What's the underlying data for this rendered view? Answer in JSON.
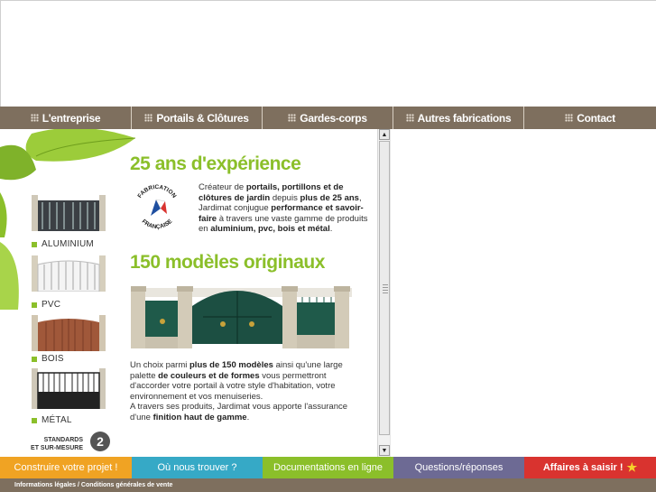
{
  "nav": {
    "items": [
      {
        "label": "L'entreprise"
      },
      {
        "label": "Portails & Clôtures"
      },
      {
        "label": "Gardes-corps"
      },
      {
        "label": "Autres fabrications"
      },
      {
        "label": "Contact"
      }
    ]
  },
  "products": [
    {
      "label": "ALUMINIUM"
    },
    {
      "label": "PVC"
    },
    {
      "label": "BOIS"
    },
    {
      "label": "MÉTAL"
    }
  ],
  "standards": {
    "line1": "STANDARDS",
    "line2": "ET SUR-MESURE",
    "logo_text": "2"
  },
  "content": {
    "heading1": "25 ans d'expérience",
    "heading2": "150 modèles originaux",
    "stamp": {
      "text_top": "FABRICATION",
      "text_bottom": "FRANÇAISE"
    }
  },
  "bottom_nav": [
    {
      "label": "Construire votre projet !"
    },
    {
      "label": "Où nous trouver ?"
    },
    {
      "label": "Documentations en ligne"
    },
    {
      "label": "Questions/réponses"
    },
    {
      "label": "Affaires à saisir !"
    }
  ],
  "footer": {
    "text": "Informations légales / Conditions générales de vente"
  },
  "colors": {
    "nav_bg": "#7e6f5e",
    "accent_green": "#8bbf2a",
    "orange": "#f0a323",
    "blue": "#36a9c6",
    "purple": "#6d6a94",
    "red": "#d9332f"
  },
  "icons": {
    "nav_bullet": "dots-grid-icon",
    "scroll_up": "arrow-up-icon",
    "scroll_down": "arrow-down-icon",
    "star": "star-icon"
  }
}
